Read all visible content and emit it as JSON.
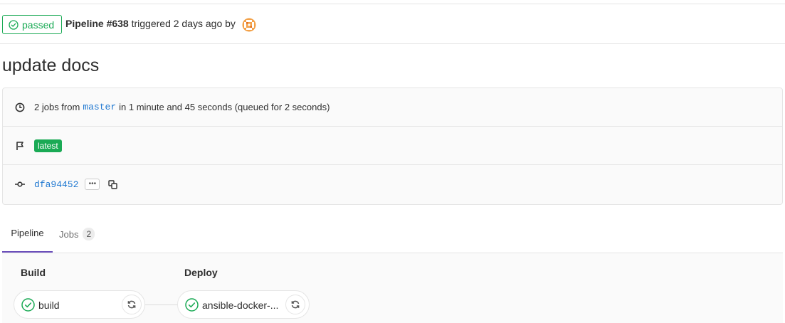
{
  "header": {
    "status_label": "passed",
    "pipeline_label": "Pipeline #638",
    "triggered_text": "triggered 2 days ago by",
    "status_color": "#1aaa55"
  },
  "commit_title": "update docs",
  "info": {
    "jobs_prefix": "2 jobs from",
    "branch": "master",
    "duration_text": "in 1 minute and 45 seconds (queued for 2 seconds)",
    "tag": "latest",
    "sha": "dfa94452",
    "ellipsis": "•••"
  },
  "tabs": {
    "pipeline": "Pipeline",
    "jobs": "Jobs",
    "jobs_count": "2"
  },
  "stages": {
    "build": {
      "title": "Build",
      "job_name": "build"
    },
    "deploy": {
      "title": "Deploy",
      "job_name": "ansible-docker-..."
    }
  },
  "colors": {
    "success": "#1aaa55",
    "link": "#1f78d1",
    "tab_active": "#6b4fbb"
  }
}
